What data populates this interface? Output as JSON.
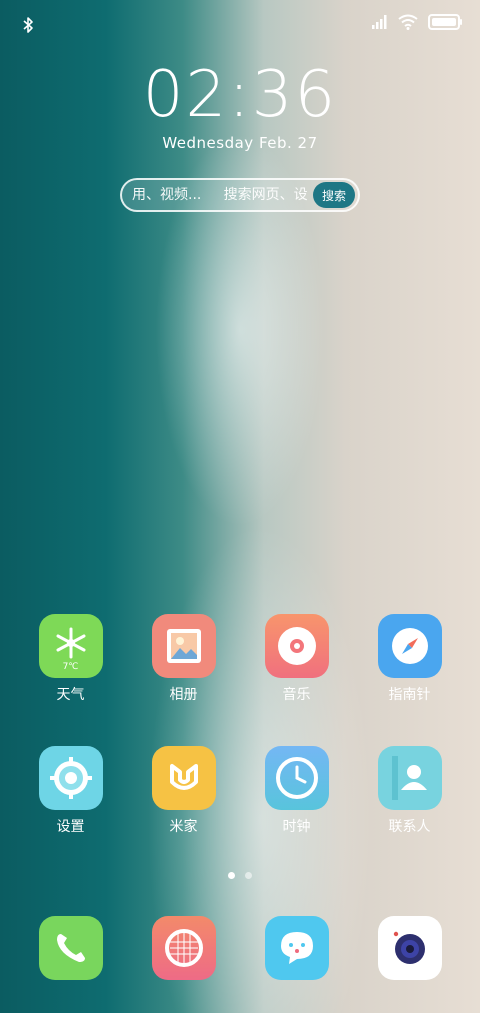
{
  "status_bar": {
    "battery_level": 1.0,
    "icons": [
      "bluetooth-icon",
      "signal-icon",
      "wifi-icon",
      "battery-icon"
    ]
  },
  "lockscreen": {
    "time": "02:36",
    "date": "Wednesday  Feb. 27"
  },
  "search": {
    "placeholder": "用、视频...     搜索网页、设",
    "button_label": "搜索"
  },
  "apps": [
    {
      "label": "天气",
      "icon": "weather-icon",
      "color": "#7ed957",
      "badge": "7℃"
    },
    {
      "label": "相册",
      "icon": "gallery-icon",
      "color": "#f18a7c"
    },
    {
      "label": "音乐",
      "icon": "music-icon",
      "color": "#f6826a"
    },
    {
      "label": "指南针",
      "icon": "compass-icon",
      "color": "#4aa6ef"
    },
    {
      "label": "设置",
      "icon": "settings-icon",
      "color": "#6ed5e6"
    },
    {
      "label": "米家",
      "icon": "mijia-icon",
      "color": "#f6c244"
    },
    {
      "label": "时钟",
      "icon": "clock-icon",
      "color": "#6ab9f4"
    },
    {
      "label": "联系人",
      "icon": "contacts-icon",
      "color": "#78d3df"
    }
  ],
  "pages": {
    "count": 2,
    "active": 0
  },
  "dock": [
    {
      "icon": "phone-icon",
      "color": "#79d65d"
    },
    {
      "icon": "browser-icon",
      "color": "#f07878"
    },
    {
      "icon": "messages-icon",
      "color": "#4fc8ef"
    },
    {
      "icon": "camera-icon",
      "color": "#ffffff"
    }
  ]
}
